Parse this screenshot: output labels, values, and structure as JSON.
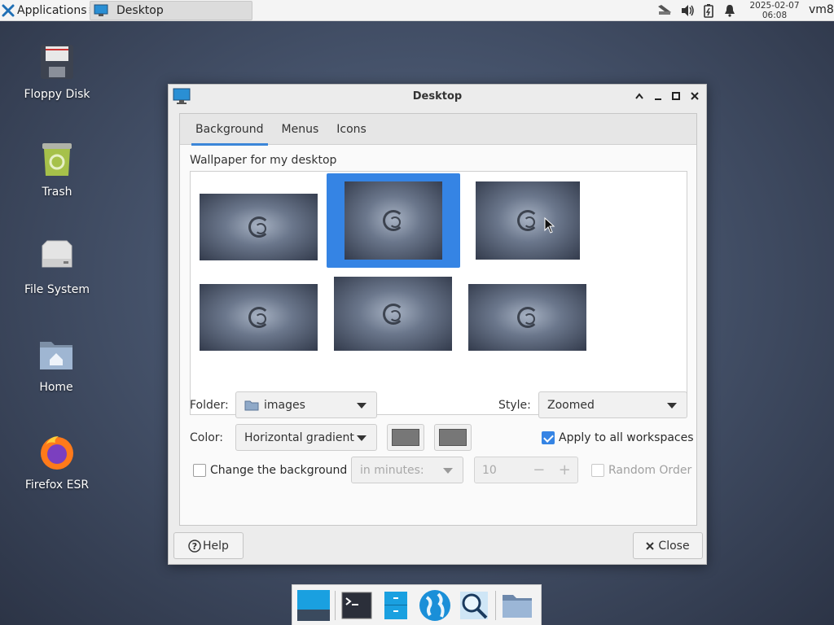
{
  "top_panel": {
    "applications_label": "Applications",
    "task_title": "Desktop",
    "clock_date": "2025-02-07",
    "clock_time": "06:08",
    "user": "vm8"
  },
  "desktop_icons": [
    {
      "label": "Floppy Disk",
      "icon": "floppy-disk-icon"
    },
    {
      "label": "Trash",
      "icon": "trash-icon"
    },
    {
      "label": "File System",
      "icon": "drive-icon"
    },
    {
      "label": "Home",
      "icon": "home-folder-icon"
    },
    {
      "label": "Firefox ESR",
      "icon": "firefox-icon"
    }
  ],
  "dialog": {
    "title": "Desktop",
    "tabs": [
      {
        "label": "Background",
        "active": true
      },
      {
        "label": "Menus",
        "active": false
      },
      {
        "label": "Icons",
        "active": false
      }
    ],
    "wallpaper_label": "Wallpaper for my desktop",
    "selected_wallpaper_index": 1,
    "folder_label": "Folder:",
    "folder_value": "images",
    "style_label": "Style:",
    "style_value": "Zoomed",
    "color_label": "Color:",
    "color_value": "Horizontal gradient",
    "color_1": "#777777",
    "color_2": "#777777",
    "apply_all_label": "Apply to all workspaces",
    "apply_all_checked": true,
    "change_bg_label": "Change the background",
    "change_bg_checked": false,
    "interval_unit": "in minutes:",
    "interval_value": "10",
    "random_order_label": "Random Order",
    "random_order_checked": false,
    "help_label": "Help",
    "close_label": "Close"
  },
  "colors": {
    "accent": "#3584e4",
    "desktop_bg": "#45526a"
  }
}
